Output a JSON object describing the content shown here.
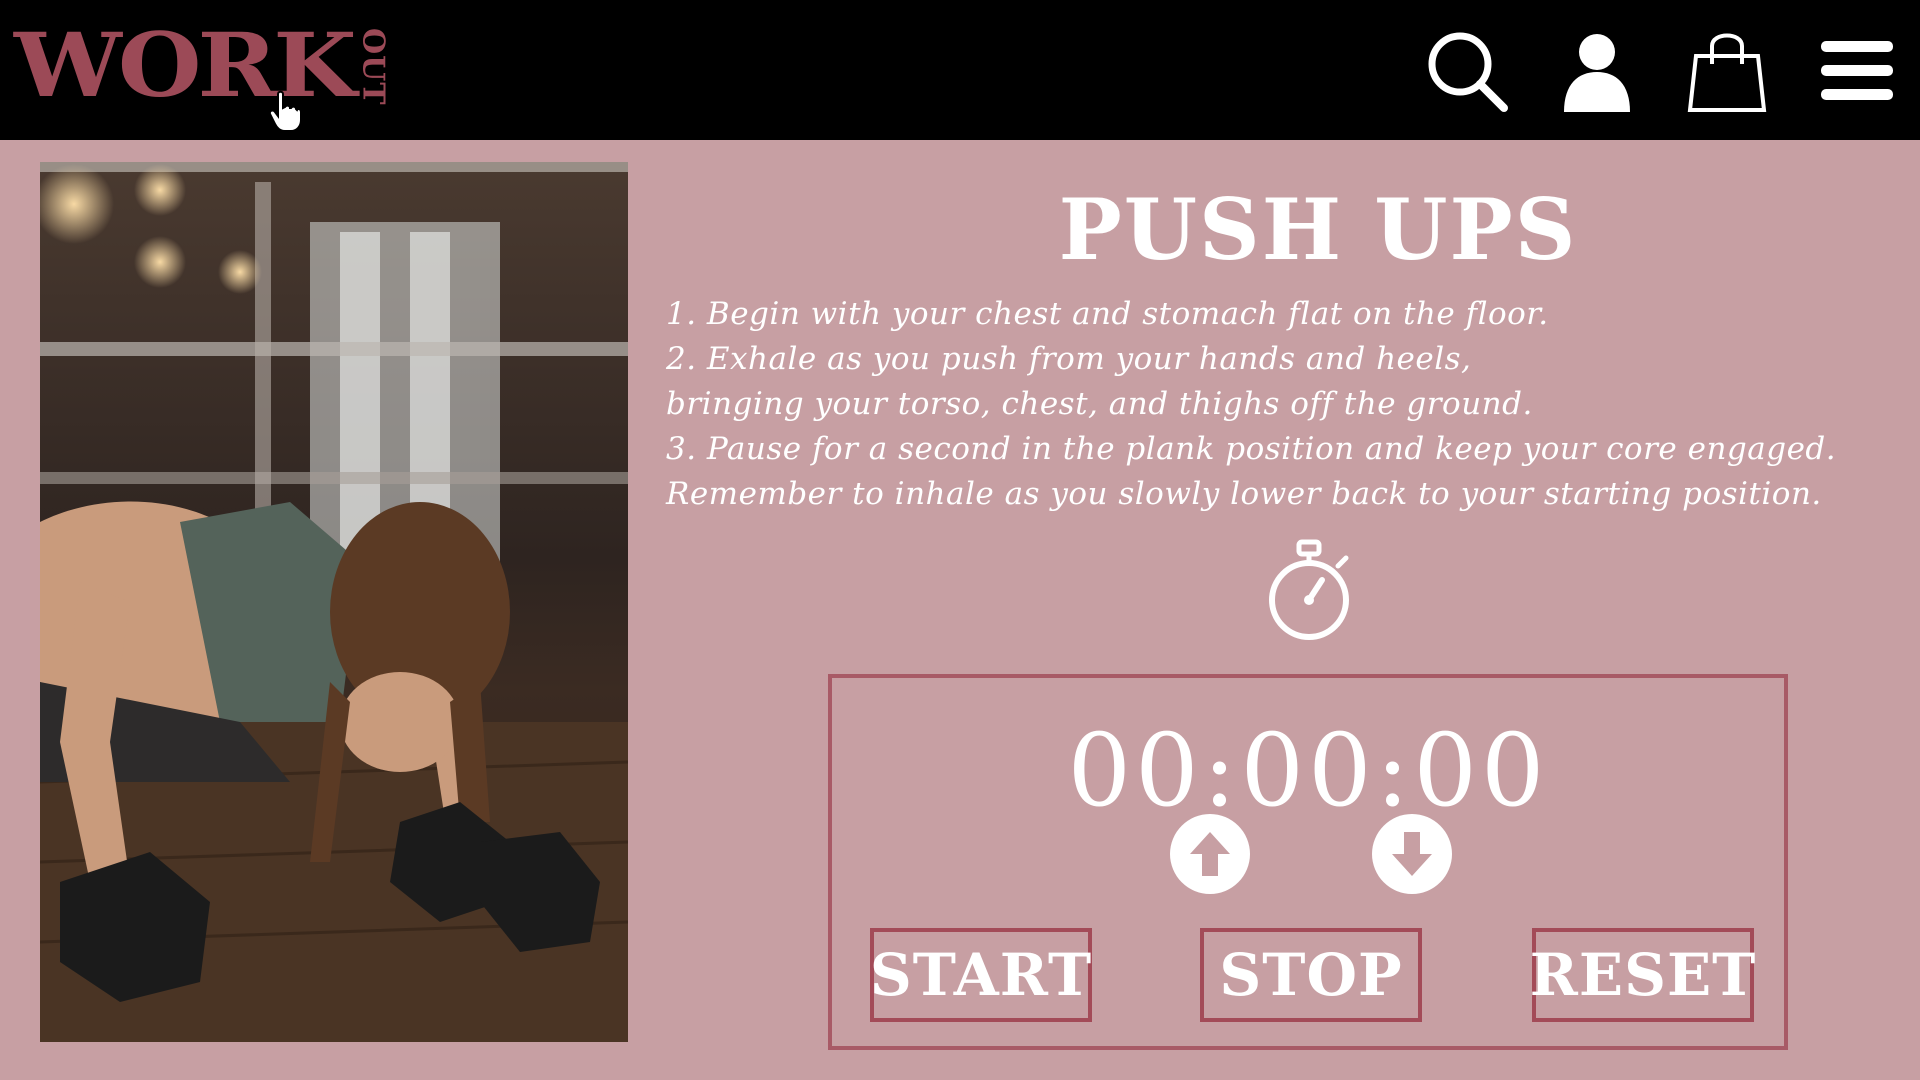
{
  "header": {
    "logo_main": "WORK",
    "logo_sub": "OUT",
    "icons": [
      "search-icon",
      "user-icon",
      "shopping-bag-icon",
      "menu-icon"
    ]
  },
  "exercise": {
    "title": "PUSH UPS",
    "instructions": [
      "1. Begin with your chest and stomach flat on the floor.",
      "2. Exhale as you push from your hands and heels,",
      "bringing your torso, chest, and thighs off the ground.",
      "3. Pause for a second in the plank position and keep your core engaged.",
      "Remember to inhale as you slowly lower back to your starting position."
    ]
  },
  "timer": {
    "display": "00:00:00",
    "buttons": {
      "start": "START",
      "stop": "STOP",
      "reset": "RESET"
    }
  },
  "colors": {
    "header_bg": "#000000",
    "page_bg": "#c79fa3",
    "brand": "#9c4a57",
    "border": "#a34b58",
    "text": "#ffffff"
  }
}
